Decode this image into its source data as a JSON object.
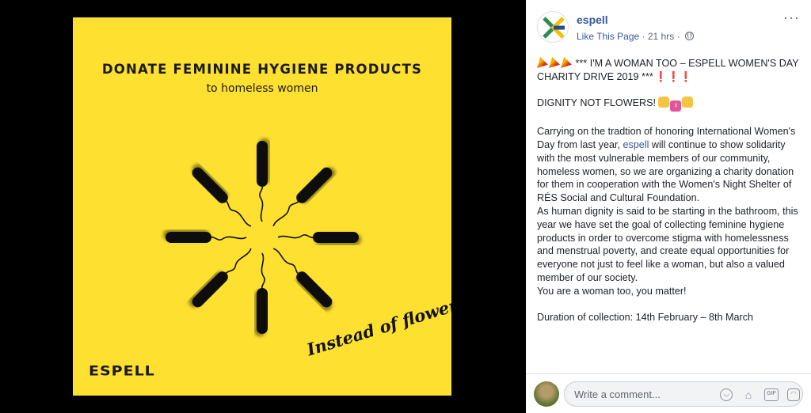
{
  "poster": {
    "title": "DONATE FEMININE HYGIENE PRODUCTS",
    "subtitle": "to homeless women",
    "logo_text": "ESPELL",
    "script_text": "Instead of flowers",
    "background_color": "#fde030",
    "illustration": "tampon-starburst"
  },
  "post": {
    "page_name": "espell",
    "like_link": "Like This Page",
    "separator": "·",
    "timestamp": "21 hrs",
    "separator2": "·",
    "audience_icon": "globe-icon",
    "more_icon": "···",
    "headline": "*** I'M A WOMAN TOO – ESPELL WOMEN'S DAY CHARITY DRIVE 2019 ***",
    "headline_marks": "❗❗❗",
    "slogan": "DIGNITY NOT FLOWERS!",
    "venus_glyph": "♀",
    "para1_before": "Carrying on the tradtion of honoring International Women's Day from last year, ",
    "para1_mention": "espell",
    "para1_after": " will continue to show solidarity with the most vulnerable members of our community, homeless women, so we are organizing a charity donation for them in cooperation with the Women's Night Shelter of RÉS Social and Cultural Foundation.",
    "para2": "As human dignity is said to be starting in the bathroom, this year we have set the goal of collecting feminine hygiene products in order to overcome stigma with homelessness and menstrual poverty, and create equal opportunities for everyone not just to feel like a woman, but also a valued member of our society.",
    "para3": "You are a woman too, you matter!",
    "duration": "Duration of collection: 14th February – 8th March"
  },
  "comment": {
    "placeholder": "Write a comment...",
    "icons": [
      "smiley-icon",
      "camera-icon",
      "gif-icon",
      "sticker-icon"
    ],
    "smiley_glyph": "◡",
    "camera_glyph": "⌂",
    "gif_label": "GIF",
    "sticker_glyph": "◠"
  },
  "colors": {
    "link": "#385898",
    "text": "#1d2129",
    "meta": "#606770"
  }
}
